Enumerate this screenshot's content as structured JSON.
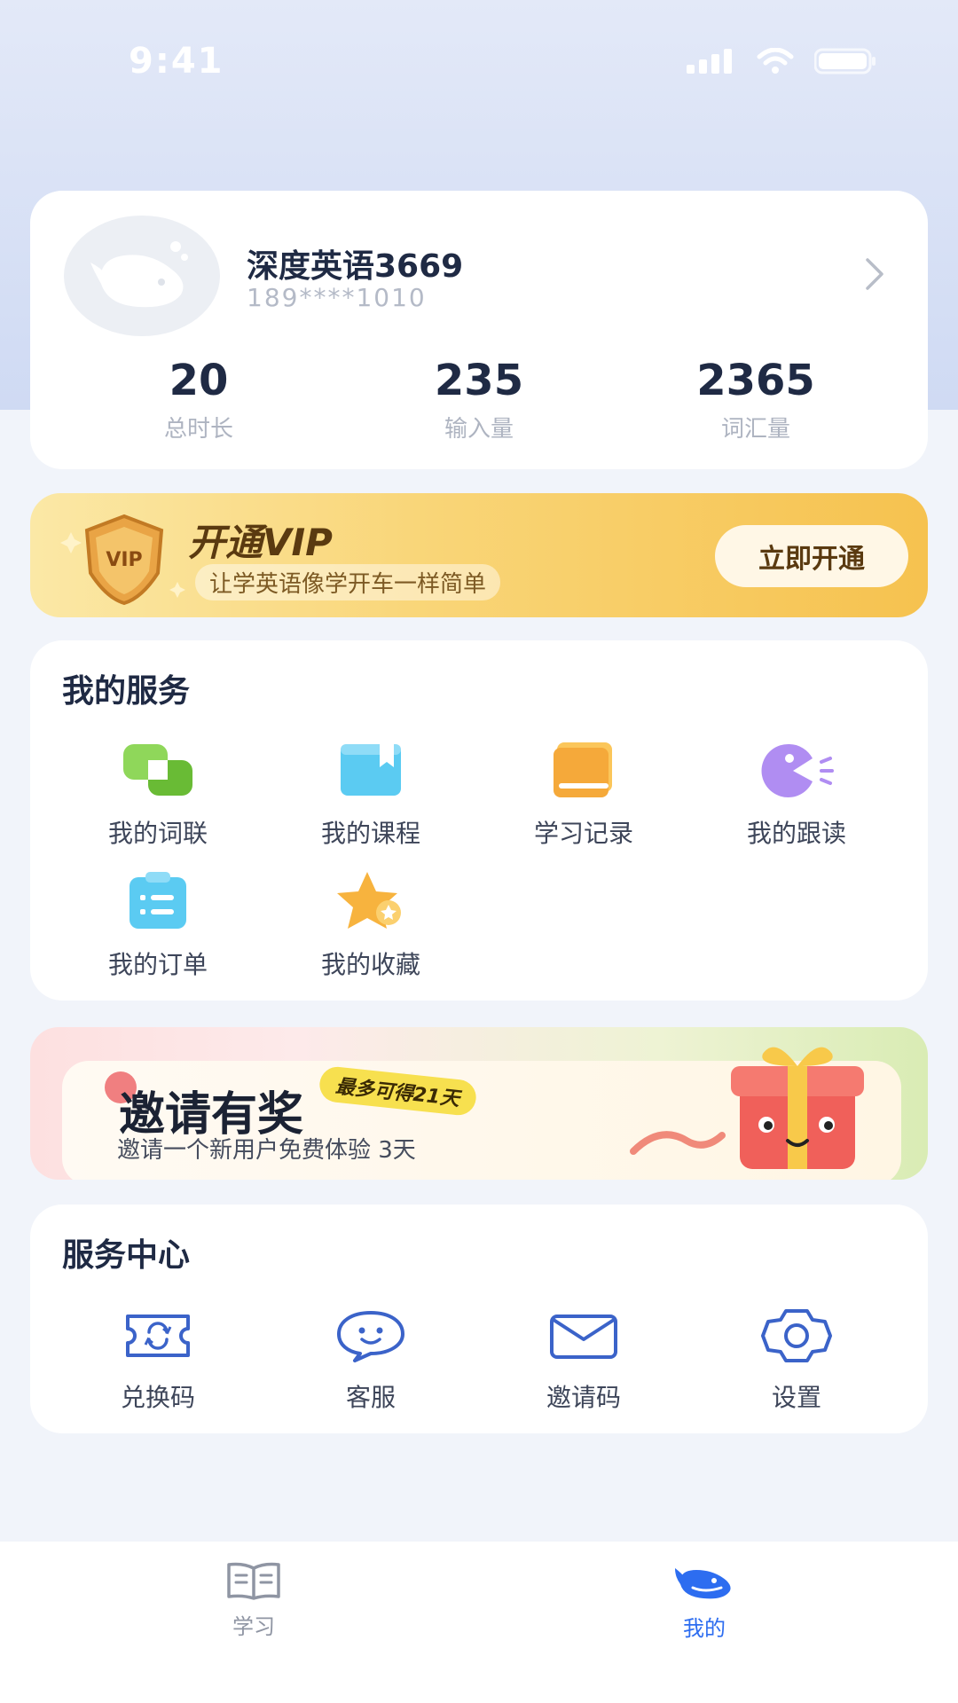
{
  "status": {
    "time": "9:41"
  },
  "profile": {
    "name": "深度英语3669",
    "phone": "189****1010",
    "stats": [
      {
        "value": "20",
        "label": "总时长"
      },
      {
        "value": "235",
        "label": "输入量"
      },
      {
        "value": "2365",
        "label": "词汇量"
      }
    ]
  },
  "vip": {
    "title": "开通VIP",
    "subtitle": "让学英语像学开车一样简单",
    "badge_text": "VIP",
    "button": "立即开通"
  },
  "services": {
    "title": "我的服务",
    "items": [
      {
        "label": "我的词联",
        "icon": "chain-icon",
        "color": "#7fcb46"
      },
      {
        "label": "我的课程",
        "icon": "course-book-icon",
        "color": "#4fc3ee"
      },
      {
        "label": "学习记录",
        "icon": "record-book-icon",
        "color": "#f6b03d"
      },
      {
        "label": "我的跟读",
        "icon": "speak-icon",
        "color": "#a983f0"
      },
      {
        "label": "我的订单",
        "icon": "order-clipboard-icon",
        "color": "#4fc3ee"
      },
      {
        "label": "我的收藏",
        "icon": "star-icon",
        "color": "#f6b03d"
      }
    ]
  },
  "invite": {
    "title": "邀请有奖",
    "tag": "最多可得21天",
    "subtitle": "邀请一个新用户免费体验 3天"
  },
  "service_center": {
    "title": "服务中心",
    "items": [
      {
        "label": "兑换码",
        "icon": "redeem-ticket-icon"
      },
      {
        "label": "客服",
        "icon": "customer-service-icon"
      },
      {
        "label": "邀请码",
        "icon": "envelope-icon"
      },
      {
        "label": "设置",
        "icon": "gear-icon"
      }
    ]
  },
  "tabs": [
    {
      "label": "学习",
      "icon": "open-book-icon",
      "active": false
    },
    {
      "label": "我的",
      "icon": "whale-icon",
      "active": true
    }
  ],
  "colors": {
    "accent": "#2d6df0",
    "vip_gold": "#f6c24f",
    "icon_line": "#3b63c9"
  }
}
